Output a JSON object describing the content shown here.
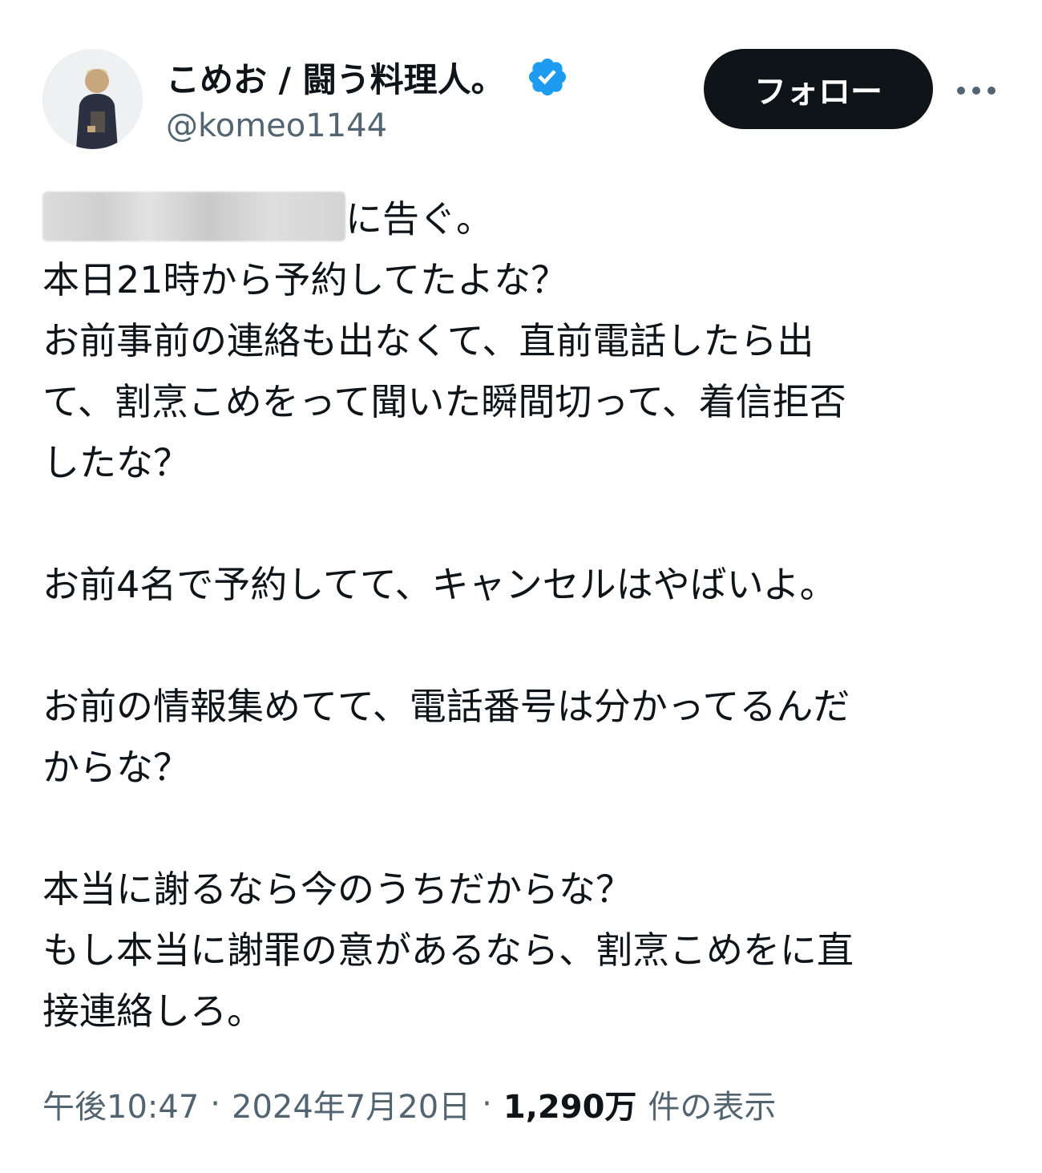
{
  "author": {
    "display_name": "こめお / 闘う料理人。",
    "handle": "@komeo1144",
    "verified_icon": "verified-badge-icon",
    "verified_color": "#1d9bf0"
  },
  "actions": {
    "follow_label": "フォロー",
    "more_icon": "more-options-icon"
  },
  "post": {
    "first_line_suffix": "に告ぐ。",
    "lines": [
      "本日21時から予約してたよな？",
      "お前事前の連絡も出なくて、直前電話したら出",
      "て、割烹こめをって聞いた瞬間切って、着信拒否",
      "したな？",
      "",
      "お前4名で予約してて、キャンセルはやばいよ。",
      "",
      "お前の情報集めてて、電話番号は分かってるんだ",
      "からな？",
      "",
      "本当に謝るなら今のうちだからな？",
      "もし本当に謝罪の意があるなら、割烹こめをに直",
      "接連絡しろ。"
    ]
  },
  "meta": {
    "time": "午後10:47",
    "separator": "·",
    "date": "2024年7月20日",
    "views_count": "1,290万",
    "views_label": "件の表示"
  },
  "colors": {
    "text": "#0f1419",
    "secondary_text": "#536471",
    "follow_bg": "#0f1419",
    "follow_text": "#ffffff"
  }
}
